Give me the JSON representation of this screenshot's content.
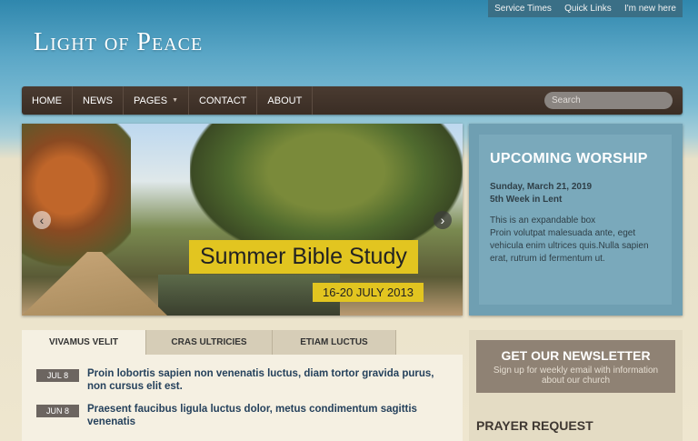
{
  "utility_links": [
    "Service Times",
    "Quick Links",
    "I'm new here"
  ],
  "site_title": "Light of Peace",
  "nav": {
    "items": [
      "HOME",
      "NEWS",
      "PAGES",
      "CONTACT",
      "ABOUT"
    ],
    "search_placeholder": "Search"
  },
  "slider": {
    "caption_title": "Summer Bible Study",
    "caption_date": "16-20 JULY 2013",
    "prev_icon": "chevron-left-icon",
    "next_icon": "chevron-right-icon"
  },
  "worship": {
    "title": "UPCOMING WORSHIP",
    "date": "Sunday, March 21, 2019",
    "week": "5th Week in Lent",
    "body_line1": "This is an expandable box",
    "body_line2": "Proin volutpat malesuada ante, eget vehicula enim ultrices quis.Nulla sapien erat, rutrum id fermentum ut."
  },
  "tabs": [
    "VIVAMUS VELIT",
    "CRAS ULTRICIES",
    "ETIAM LUCTUS"
  ],
  "news_items": [
    {
      "date": "JUL 8",
      "text": "Proin lobortis sapien non venenatis luctus, diam tortor gravida purus, non cursus elit est."
    },
    {
      "date": "JUN 8",
      "text": "Praesent faucibus ligula luctus dolor, metus condimentum sagittis venenatis"
    }
  ],
  "newsletter": {
    "title": "GET OUR NEWSLETTER",
    "subtitle": "Sign up for weekly email with information about our church"
  },
  "prayer_title": "PRAYER REQUEST",
  "colors": {
    "nav": "#3f3128",
    "accent_yellow": "#e2c520",
    "worship_blue": "#6f9fb2"
  }
}
